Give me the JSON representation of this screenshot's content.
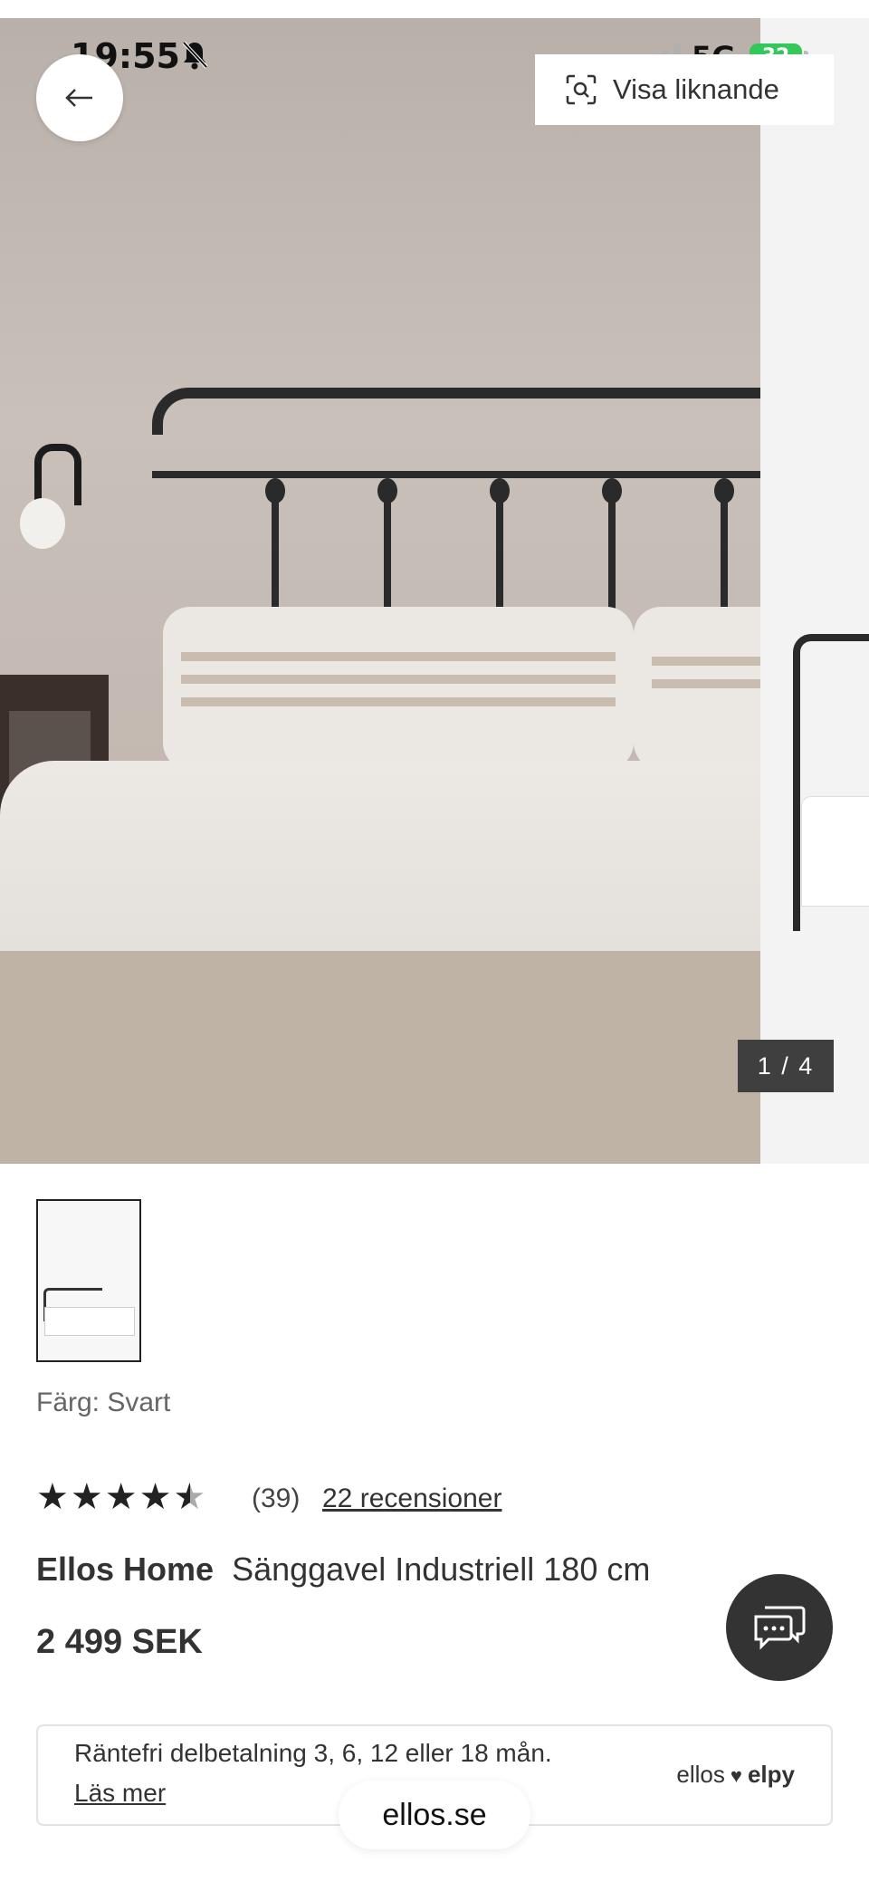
{
  "status_bar": {
    "time": "19:55",
    "network": "5G",
    "battery": "32"
  },
  "gallery": {
    "similar_label": "Visa liknande",
    "counter": "1 / 4",
    "current": 1,
    "total": 4
  },
  "product": {
    "color_label": "Färg: Svart",
    "rating": {
      "stars": 4.5,
      "count": "(39)",
      "reviews_label": "22 recensioner"
    },
    "brand": "Ellos Home",
    "name": "Sänggavel Industriell 180 cm",
    "price": "2 499 SEK"
  },
  "financing": {
    "text": "Räntefri delbetalning 3, 6, 12 eller 18 mån.",
    "link": "Läs mer",
    "logo_left": "ellos",
    "logo_right": "elpy"
  },
  "browser": {
    "url": "ellos.se"
  },
  "icons": {
    "back": "arrow-left-icon",
    "similar": "visual-search-icon",
    "chat": "chat-bubble-icon",
    "bell": "bell-slash-icon"
  },
  "colors": {
    "accent_dark": "#333333",
    "battery": "#34c759",
    "counter_bg": "#3f3f3f"
  }
}
